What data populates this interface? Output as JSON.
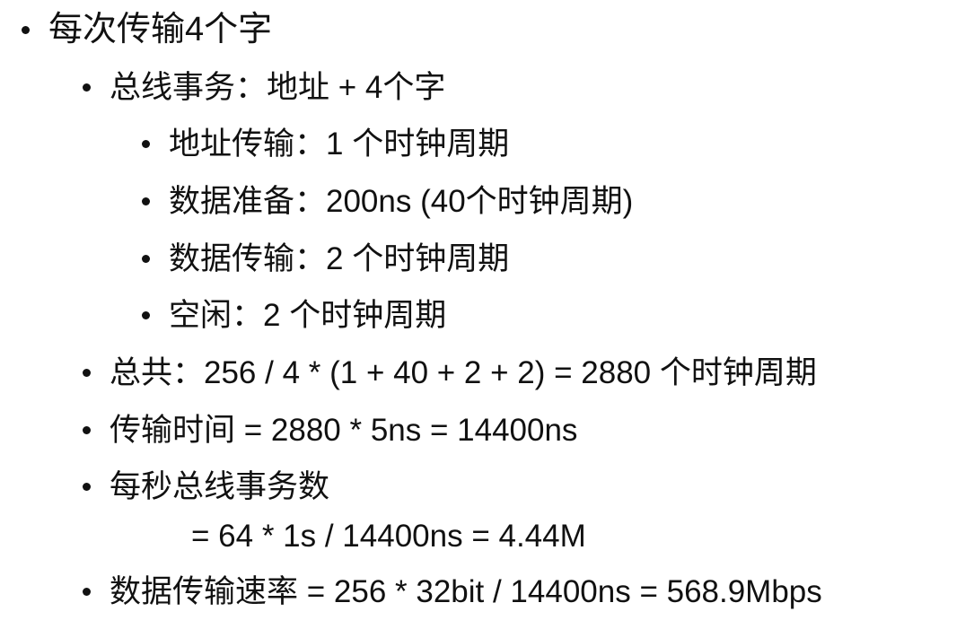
{
  "slide": {
    "items": [
      {
        "text": "每次传输4个字"
      },
      {
        "text": "总线事务：地址 + 4个字"
      },
      {
        "text": "地址传输：1 个时钟周期"
      },
      {
        "text": "数据准备：200ns (40个时钟周期)"
      },
      {
        "text": "数据传输：2 个时钟周期"
      },
      {
        "text": "空闲：2 个时钟周期"
      },
      {
        "text": "总共：256 / 4 * (1 + 40 + 2 + 2) = 2880 个时钟周期"
      },
      {
        "text": "传输时间 = 2880 * 5ns = 14400ns"
      },
      {
        "text": "每秒总线事务数"
      },
      {
        "text": "= 64 * 1s / 14400ns = 4.44M"
      },
      {
        "text": "数据传输速率 = 256 * 32bit / 14400ns = 568.9Mbps"
      }
    ]
  }
}
